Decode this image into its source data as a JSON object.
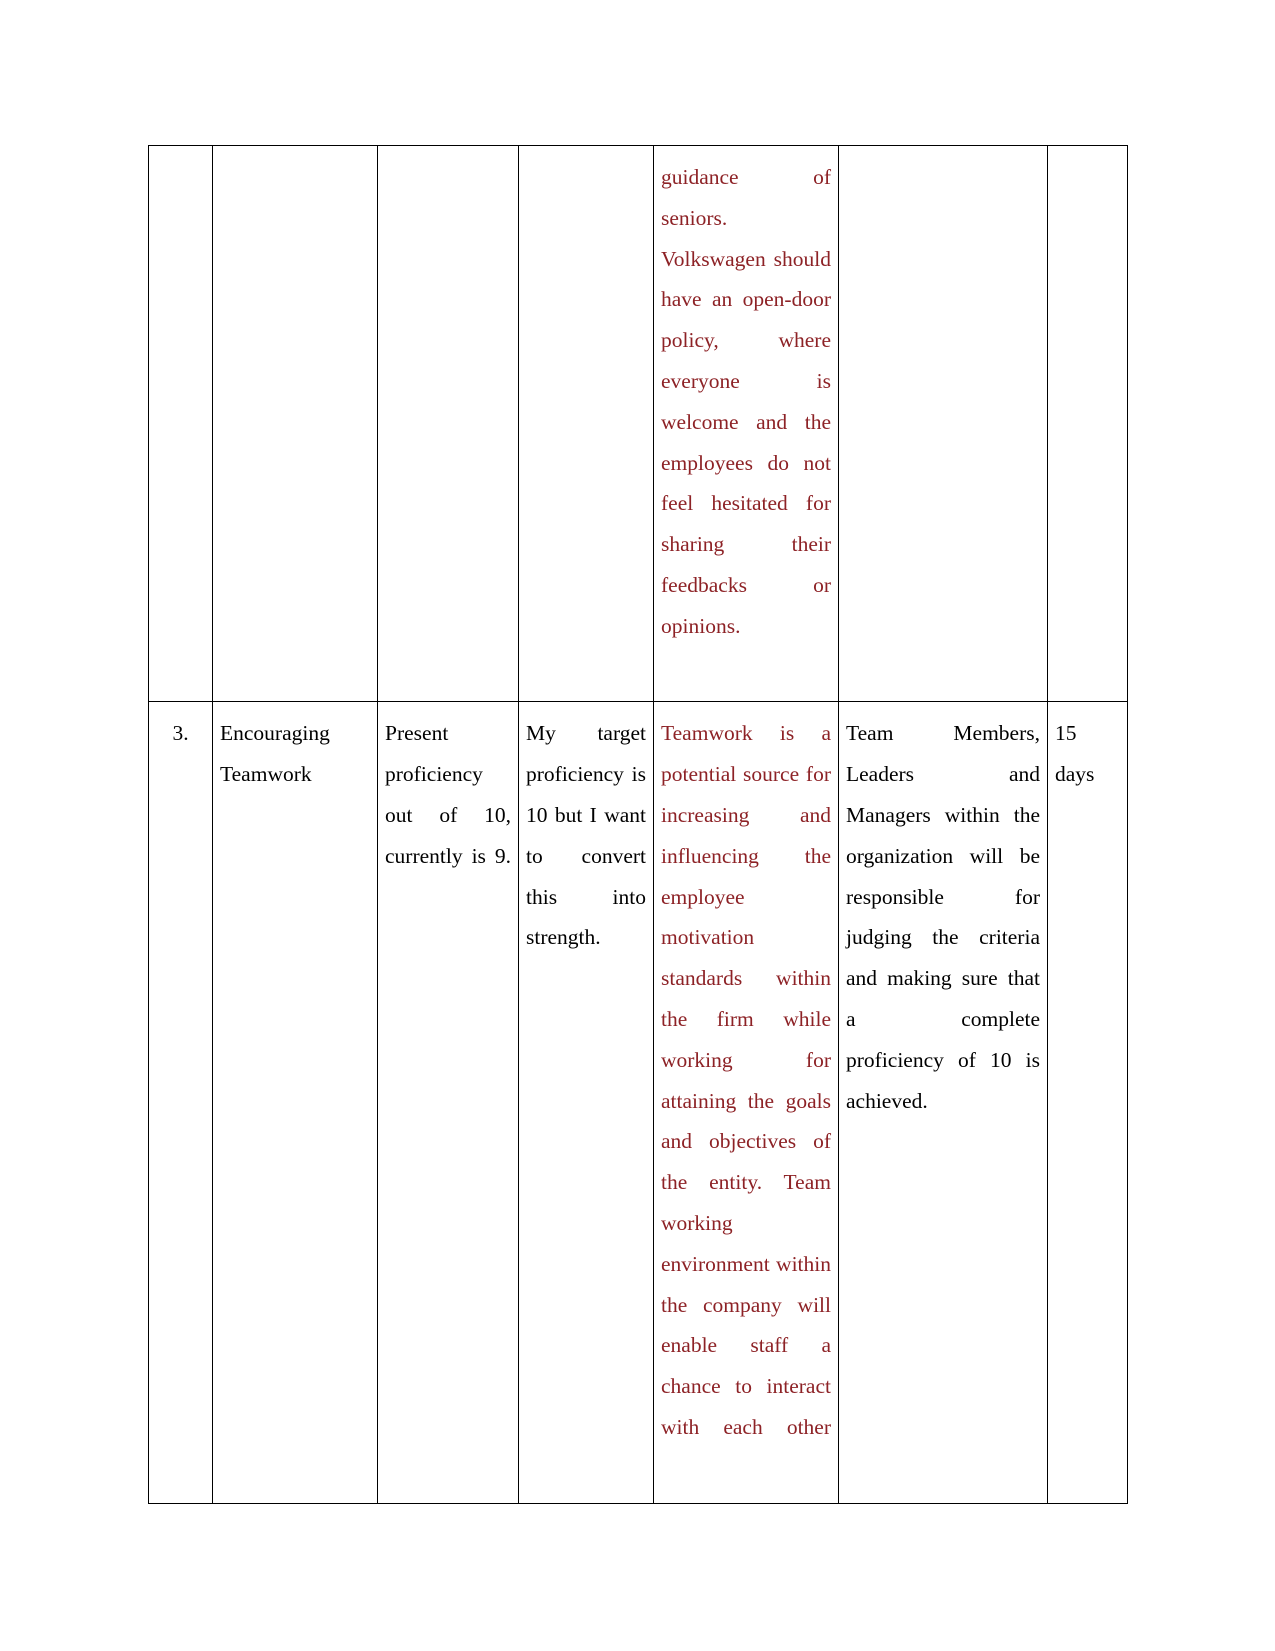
{
  "document": {
    "type": "table-continuation",
    "text_colors": {
      "accent_red": "#8d2226",
      "body_black": "#000000",
      "border": "#000000",
      "page_background": "#ffffff"
    }
  },
  "table": {
    "columns": 7,
    "rows": [
      {
        "id": "row-continued",
        "cells": {
          "sr_no": "",
          "area": "",
          "present_proficiency": "",
          "target_proficiency": "",
          "development_opportunities": "guidance of seniors. Volkswagen should have an open-door policy, where everyone is welcome and the employees do not feel hesitated for sharing their feedbacks or opinions.",
          "criteria_judging_success": "",
          "time_frame": ""
        }
      },
      {
        "id": "row-3",
        "cells": {
          "sr_no": "3.",
          "area": "Encouraging Teamwork",
          "present_proficiency": "Present proficiency out of 10, currently is 9.",
          "target_proficiency": "My target proficiency is 10 but I want to convert this into strength.",
          "development_opportunities": "Teamwork is a potential source for increasing and influencing the employee motivation standards within the firm while working for attaining the goals and objectives of the entity. Team working environment within the company will enable staff a chance to interact with each other",
          "criteria_judging_success": "Team Members, Leaders and Managers within the organization will be responsible for judging the criteria and making sure that a complete proficiency of 10 is achieved.",
          "time_frame": "15 days"
        }
      }
    ]
  }
}
